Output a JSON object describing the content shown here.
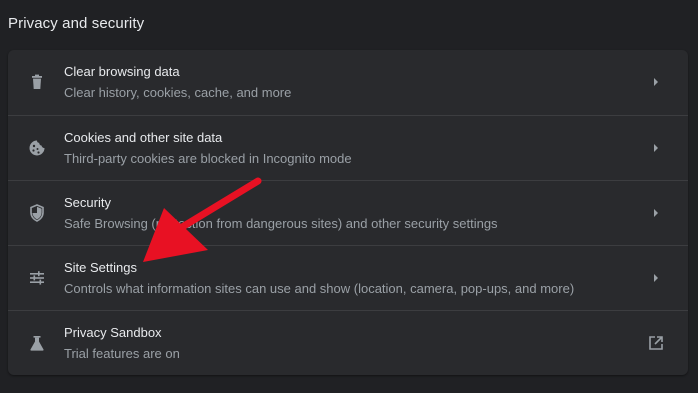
{
  "section": {
    "title": "Privacy and security"
  },
  "rows": [
    {
      "title": "Clear browsing data",
      "subtitle": "Clear history, cookies, cache, and more",
      "icon": "trash-icon",
      "action_icon": "chevron-right-icon"
    },
    {
      "title": "Cookies and other site data",
      "subtitle": "Third-party cookies are blocked in Incognito mode",
      "icon": "cookie-icon",
      "action_icon": "chevron-right-icon"
    },
    {
      "title": "Security",
      "subtitle": "Safe Browsing (protection from dangerous sites) and other security settings",
      "icon": "shield-icon",
      "action_icon": "chevron-right-icon"
    },
    {
      "title": "Site Settings",
      "subtitle": "Controls what information sites can use and show (location, camera, pop-ups, and more)",
      "icon": "sliders-icon",
      "action_icon": "chevron-right-icon"
    },
    {
      "title": "Privacy Sandbox",
      "subtitle": "Trial features are on",
      "icon": "flask-icon",
      "action_icon": "open-in-new-icon"
    }
  ],
  "colors": {
    "background": "#202124",
    "card": "#292a2d",
    "text_primary": "#e8eaed",
    "text_secondary": "#9aa0a6",
    "icon": "#9aa0a6",
    "annotation_arrow": "#e81123"
  }
}
